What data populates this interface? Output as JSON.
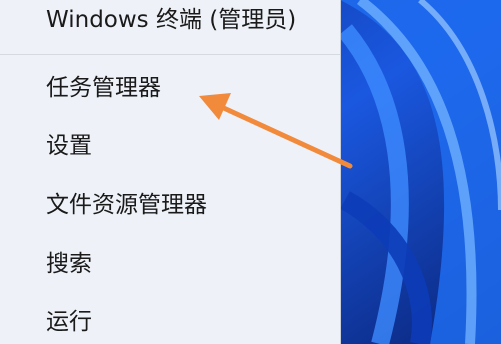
{
  "menu": {
    "items": [
      {
        "label": "Windows 终端 (管理员)"
      },
      {
        "label": "任务管理器"
      },
      {
        "label": "设置"
      },
      {
        "label": "文件资源管理器"
      },
      {
        "label": "搜索"
      },
      {
        "label": "运行"
      }
    ]
  },
  "colors": {
    "menu_bg": "#eef2f8",
    "arrow": "#f28a3c",
    "wallpaper": "#0a3aa8"
  }
}
